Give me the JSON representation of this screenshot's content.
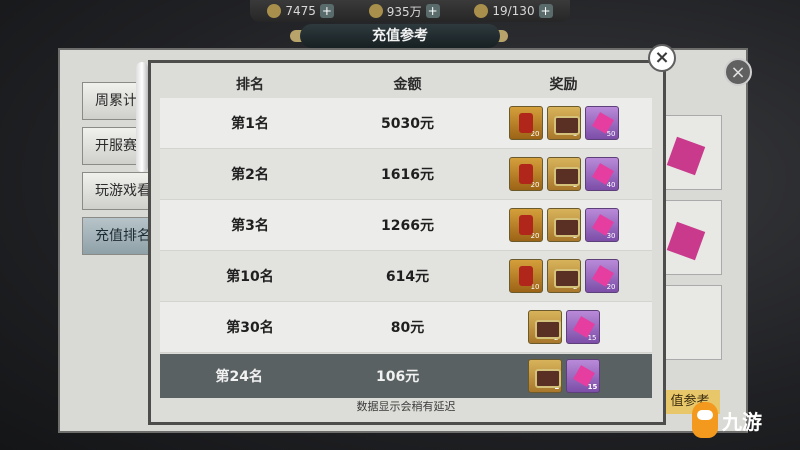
{
  "top_bar": {
    "resources": [
      {
        "icon": "silver-ingot-icon",
        "value": "7475"
      },
      {
        "icon": "gold-ingot-icon",
        "value": "935万"
      },
      {
        "icon": "energy-icon",
        "value": "19/130"
      }
    ]
  },
  "background_panel": {
    "tabs": [
      "周累计",
      "开服赛",
      "玩游戏看",
      "充值排名"
    ],
    "button_label": "值参考"
  },
  "dialog": {
    "title": "充值参考",
    "close_icon": "close-icon",
    "headers": {
      "rank": "排名",
      "amount": "金额",
      "reward": "奖励"
    },
    "rows": [
      {
        "rank": "第1名",
        "amount": "5030元",
        "rewards": [
          {
            "type": "armor",
            "qty": "20"
          },
          {
            "type": "chest",
            "qty": "3"
          },
          {
            "type": "gem",
            "qty": "50"
          }
        ]
      },
      {
        "rank": "第2名",
        "amount": "1616元",
        "rewards": [
          {
            "type": "armor",
            "qty": "20"
          },
          {
            "type": "chest",
            "qty": "2"
          },
          {
            "type": "gem",
            "qty": "40"
          }
        ]
      },
      {
        "rank": "第3名",
        "amount": "1266元",
        "rewards": [
          {
            "type": "armor",
            "qty": "20"
          },
          {
            "type": "chest",
            "qty": "2"
          },
          {
            "type": "gem",
            "qty": "30"
          }
        ]
      },
      {
        "rank": "第10名",
        "amount": "614元",
        "rewards": [
          {
            "type": "armor",
            "qty": "10"
          },
          {
            "type": "chest",
            "qty": "2"
          },
          {
            "type": "gem",
            "qty": "20"
          }
        ]
      },
      {
        "rank": "第30名",
        "amount": "80元",
        "rewards": [
          {
            "type": "chest",
            "qty": "2"
          },
          {
            "type": "gem",
            "qty": "15"
          }
        ]
      }
    ],
    "my_row": {
      "rank": "第24名",
      "amount": "106元",
      "rewards": [
        {
          "type": "chest",
          "qty": "2"
        },
        {
          "type": "gem",
          "qty": "15"
        }
      ]
    },
    "footer_note": "数据显示会稍有延迟"
  },
  "watermark": {
    "text": "九游"
  }
}
